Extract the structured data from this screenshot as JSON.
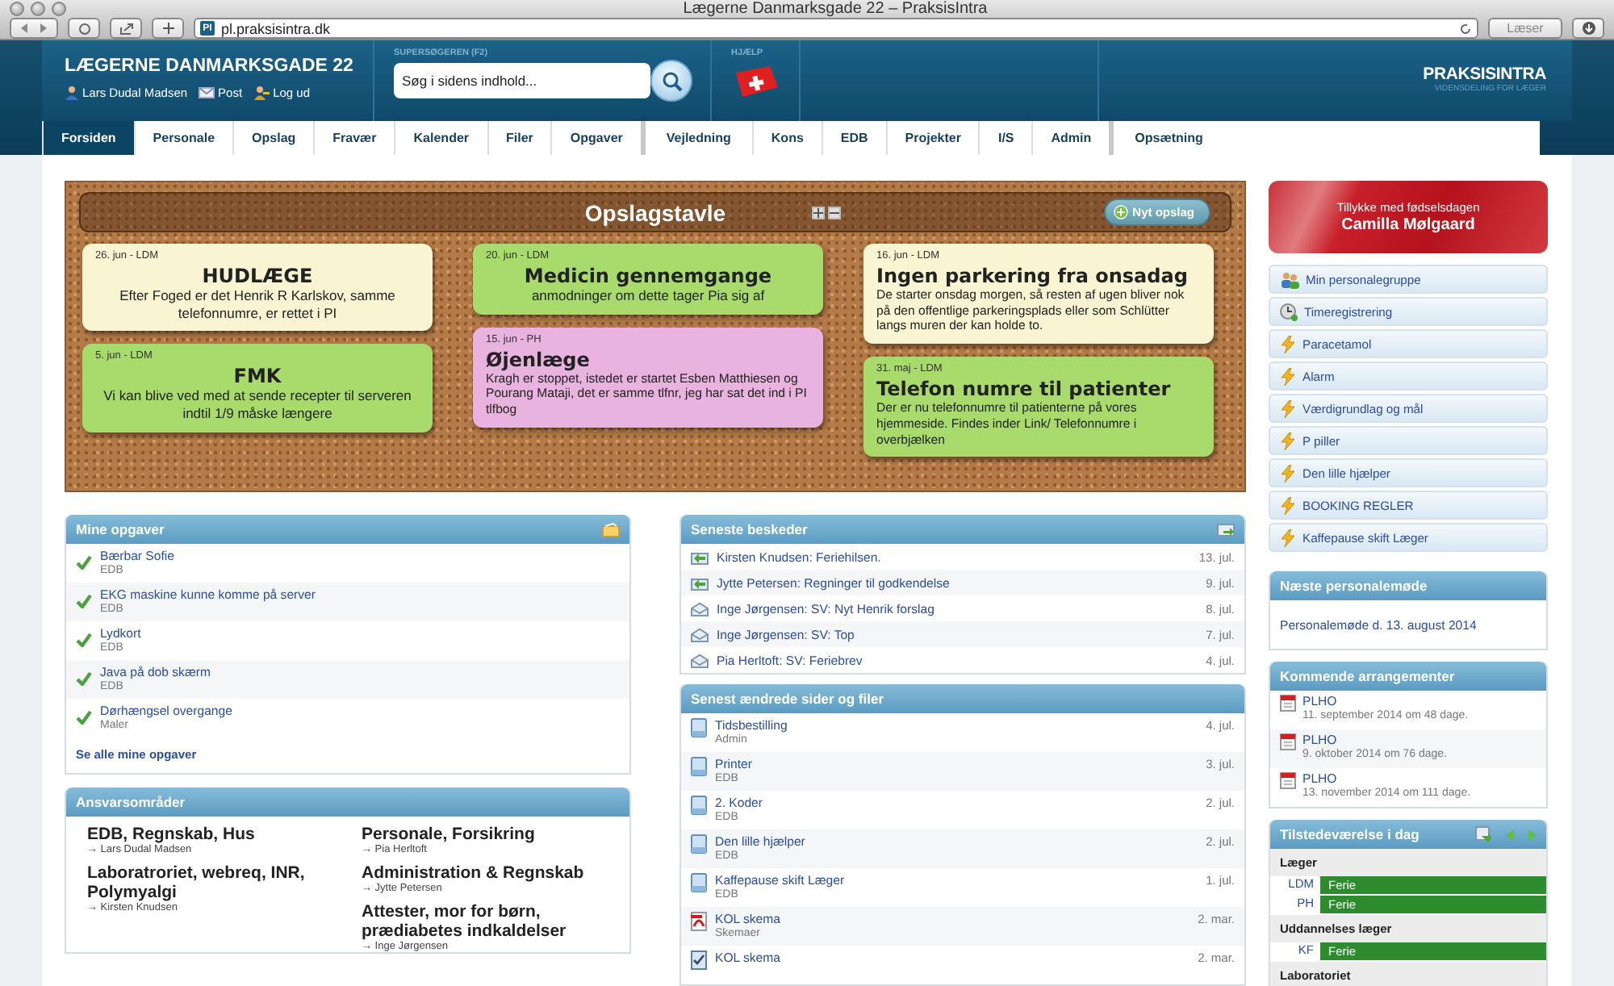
{
  "browser": {
    "title": "Lægerne Danmarksgade 22 – PraksisIntra",
    "favicon": "PI",
    "url": "pl.praksisintra.dk",
    "reader": "Læser"
  },
  "header": {
    "clinic": "LÆGERNE DANMARKSGADE 22",
    "user_links": [
      {
        "kind": "user",
        "label": "Lars Dudal Madsen"
      },
      {
        "kind": "mail",
        "label": "Post"
      },
      {
        "kind": "logout",
        "label": "Log ud"
      }
    ],
    "search_label": "SUPERSØGEREN (F2)",
    "search": {
      "placeholder": "Søg i sidens indhold..."
    },
    "help_label": "HJÆLP",
    "logo": "PRAKSISINTRA",
    "tagline": "VIDENSDELING FOR LÆGER"
  },
  "tabs": [
    {
      "label": "Forsiden",
      "selected": true,
      "group_start": false
    },
    {
      "label": "Personale",
      "selected": false,
      "group_start": false
    },
    {
      "label": "Opslag",
      "selected": false,
      "group_start": false
    },
    {
      "label": "Fravær",
      "selected": false,
      "group_start": false
    },
    {
      "label": "Kalender",
      "selected": false,
      "group_start": false
    },
    {
      "label": "Filer",
      "selected": false,
      "group_start": false
    },
    {
      "label": "Opgaver",
      "selected": false,
      "group_start": false
    },
    {
      "label": "Vejledning",
      "selected": false,
      "group_start": true
    },
    {
      "label": "Kons",
      "selected": false,
      "group_start": false
    },
    {
      "label": "EDB",
      "selected": false,
      "group_start": false
    },
    {
      "label": "Projekter",
      "selected": false,
      "group_start": false
    },
    {
      "label": "I/S",
      "selected": false,
      "group_start": false
    },
    {
      "label": "Admin",
      "selected": false,
      "group_start": false
    },
    {
      "label": "Opsætning",
      "selected": false,
      "group_start": true
    }
  ],
  "board": {
    "title": "Opslagstavle",
    "new_button": "Nyt opslag",
    "columns": [
      [
        {
          "date": "26. jun - LDM",
          "title": "HUDLÆGE",
          "body": "Efter Foged er det Henrik R Karlskov, samme telefonnumre, er rettet i PI",
          "color": "#f9f4d2",
          "centered": true
        },
        {
          "date": "5. jun - LDM",
          "title": "FMK",
          "body": "Vi kan blive ved med at sende recepter til serveren indtil 1/9 måske længere",
          "color": "#a9da6c",
          "centered": true
        }
      ],
      [
        {
          "date": "20. jun - LDM",
          "title": "Medicin gennemgange",
          "body": "anmodninger om dette tager Pia sig af",
          "color": "#a9da6c",
          "centered": true
        },
        {
          "date": "15. jun - PH",
          "title": "Øjenlæge",
          "body": "Kragh er stoppet, istedet er startet Esben Matthiesen og Pourang Mataji, det er samme tlfnr, jeg har sat det ind i PI tlfbog",
          "color": "#e9b3df",
          "centered": false
        }
      ],
      [
        {
          "date": "16. jun - LDM",
          "title": "Ingen parkering fra onsadag",
          "body": "De starter onsdag morgen, så resten af ugen bliver nok på den offentlige parkeringsplads eller som Schlütter langs muren der kan holde to.",
          "color": "#f9f4d2",
          "centered": false
        },
        {
          "date": "31. maj - LDM",
          "title": "Telefon numre til patienter",
          "body": "Der er nu telefonnumre til patienterne på vores hjemmeside. Findes inder Link/ Telefonnumre i overbjælken",
          "color": "#a9da6c",
          "centered": false
        }
      ]
    ]
  },
  "tasks": {
    "title": "Mine opgaver",
    "items": [
      {
        "title": "Bærbar Sofie",
        "category": "EDB",
        "done": true
      },
      {
        "title": "EKG maskine kunne komme på server",
        "category": "EDB",
        "done": true
      },
      {
        "title": "Lydkort",
        "category": "EDB",
        "done": true
      },
      {
        "title": "Java på dob skærm",
        "category": "EDB",
        "done": true
      },
      {
        "title": "Dørhængsel overgange",
        "category": "Maler",
        "done": true
      }
    ],
    "all_link": "Se alle mine opgaver"
  },
  "responsibilities": {
    "title": "Ansvarsområder",
    "columns": [
      [
        {
          "area": "EDB, Regnskab, Hus",
          "person": "→ Lars Dudal Madsen"
        },
        {
          "area": "Laboratroriet, webreq, INR, Polymyalgi",
          "person": "→ Kirsten Knudsen"
        }
      ],
      [
        {
          "area": "Personale, Forsikring",
          "person": "→ Pia Herltoft"
        },
        {
          "area": "Administration & Regnskab",
          "person": "→ Jytte Petersen"
        },
        {
          "area": "Attester, mor for børn, prædiabetes indkaldelser",
          "person": "→ Inge Jørgensen"
        }
      ]
    ]
  },
  "messages": {
    "title": "Seneste beskeder",
    "items": [
      {
        "kind": "new",
        "text": "Kirsten Knudsen: Feriehilsen.",
        "date": "13. jul."
      },
      {
        "kind": "new",
        "text": "Jytte Petersen: Regninger til godkendelse",
        "date": "9. jul."
      },
      {
        "kind": "read",
        "text": "Inge Jørgensen: SV: Nyt Henrik forslag",
        "date": "8. jul."
      },
      {
        "kind": "read",
        "text": "Inge Jørgensen: SV: Top",
        "date": "7. jul."
      },
      {
        "kind": "read",
        "text": "Pia Herltoft: SV: Feriebrev",
        "date": "4. jul."
      }
    ]
  },
  "files": {
    "title": "Senest ændrede sider og filer",
    "items": [
      {
        "kind": "page",
        "name": "Tidsbestilling",
        "folder": "Admin",
        "date": "4. jul."
      },
      {
        "kind": "page",
        "name": "Printer",
        "folder": "EDB",
        "date": "3. jul."
      },
      {
        "kind": "page",
        "name": "2. Koder",
        "folder": "EDB",
        "date": "2. jul."
      },
      {
        "kind": "page",
        "name": "Den lille hjælper",
        "folder": "EDB",
        "date": "2. jul."
      },
      {
        "kind": "page",
        "name": "Kaffepause skift Læger",
        "folder": "EDB",
        "date": "1. jul."
      },
      {
        "kind": "pdf",
        "name": "KOL skema",
        "folder": "Skemaer",
        "date": "2. mar."
      },
      {
        "kind": "form",
        "name": "KOL skema",
        "date": "2. mar."
      }
    ]
  },
  "birthday": {
    "greeting": "Tillykke med fødselsdagen",
    "name": "Camilla Mølgaard"
  },
  "quick_links": [
    {
      "kind": "group",
      "label": "Min personalegruppe"
    },
    {
      "kind": "clock",
      "label": "Timeregistrering"
    },
    {
      "kind": "bolt",
      "label": "Paracetamol"
    },
    {
      "kind": "bolt",
      "label": "Alarm"
    },
    {
      "kind": "bolt",
      "label": "Værdigrundlag og mål"
    },
    {
      "kind": "bolt",
      "label": "P piller"
    },
    {
      "kind": "bolt",
      "label": "Den lille hjælper"
    },
    {
      "kind": "bolt",
      "label": "BOOKING REGLER"
    },
    {
      "kind": "bolt",
      "label": "Kaffepause skift Læger"
    }
  ],
  "next_meeting": {
    "title": "Næste personalemøde",
    "link": "Personalemøde d. 13. august 2014"
  },
  "events": {
    "title": "Kommende arrangementer",
    "items": [
      {
        "name": "PLHO",
        "when": "11. september 2014 om 48 dage."
      },
      {
        "name": "PLHO",
        "when": "9. oktober 2014 om 76 dage."
      },
      {
        "name": "PLHO",
        "when": "13. november 2014 om 111 dage."
      }
    ]
  },
  "presence": {
    "title": "Tilstedeværelse i dag",
    "groups": [
      {
        "name": "Læger",
        "people": [
          {
            "initials": "LDM",
            "status": "Ferie",
            "color": "#2e8b2e"
          },
          {
            "initials": "PH",
            "status": "Ferie",
            "color": "#2e8b2e"
          }
        ]
      },
      {
        "name": "Uddannelses læger",
        "people": [
          {
            "initials": "KF",
            "status": "Ferie",
            "color": "#2e8b2e"
          }
        ]
      },
      {
        "name": "Laboratoriet"
      }
    ]
  }
}
